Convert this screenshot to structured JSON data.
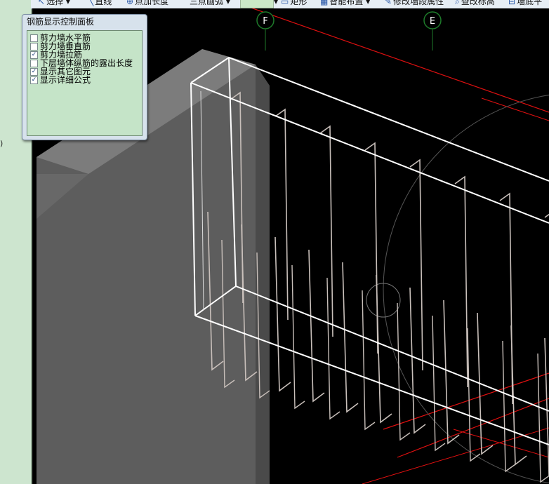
{
  "toolbar": {
    "items": [
      {
        "label": "选择",
        "icon": "pointer-icon"
      },
      {
        "label": "直线",
        "icon": "line-icon"
      },
      {
        "label": "点加长度",
        "icon": "point-length-icon"
      },
      {
        "label": "三点画弧",
        "icon": "arc-icon"
      },
      {
        "label": "矩形",
        "icon": "rectangle-icon"
      },
      {
        "label": "智能布置",
        "icon": "smart-layout-icon"
      },
      {
        "label": "修改墙段属性",
        "icon": "edit-wall-icon"
      },
      {
        "label": "查改标高",
        "icon": "elevation-icon"
      },
      {
        "label": "墙底平",
        "icon": "wall-bottom-icon"
      }
    ]
  },
  "sidebar": {
    "mark": ")"
  },
  "panel": {
    "title": "钢筋显示控制面板",
    "options": [
      {
        "label": "剪力墙水平筋",
        "checked": false
      },
      {
        "label": "剪力墙垂直筋",
        "checked": false
      },
      {
        "label": "剪力墙拉筋",
        "checked": true
      },
      {
        "label": "下层墙体纵筋的露出长度",
        "checked": false
      },
      {
        "label": "显示其它图元",
        "checked": true
      },
      {
        "label": "显示详细公式",
        "checked": true
      }
    ]
  },
  "grid_axes": [
    {
      "label": "F"
    },
    {
      "label": "E"
    }
  ],
  "colors": {
    "background": "#000000",
    "sidebar": "#cde5cf",
    "panel_body": "#c5e4c8",
    "wall_front": "#5f5f5f",
    "wall_top": "#7a7a7a",
    "rebar": "#c9c0bb",
    "frame": "#ffffff",
    "axis_line": "#e01010",
    "axis_bubble": "#1e7a2a"
  }
}
